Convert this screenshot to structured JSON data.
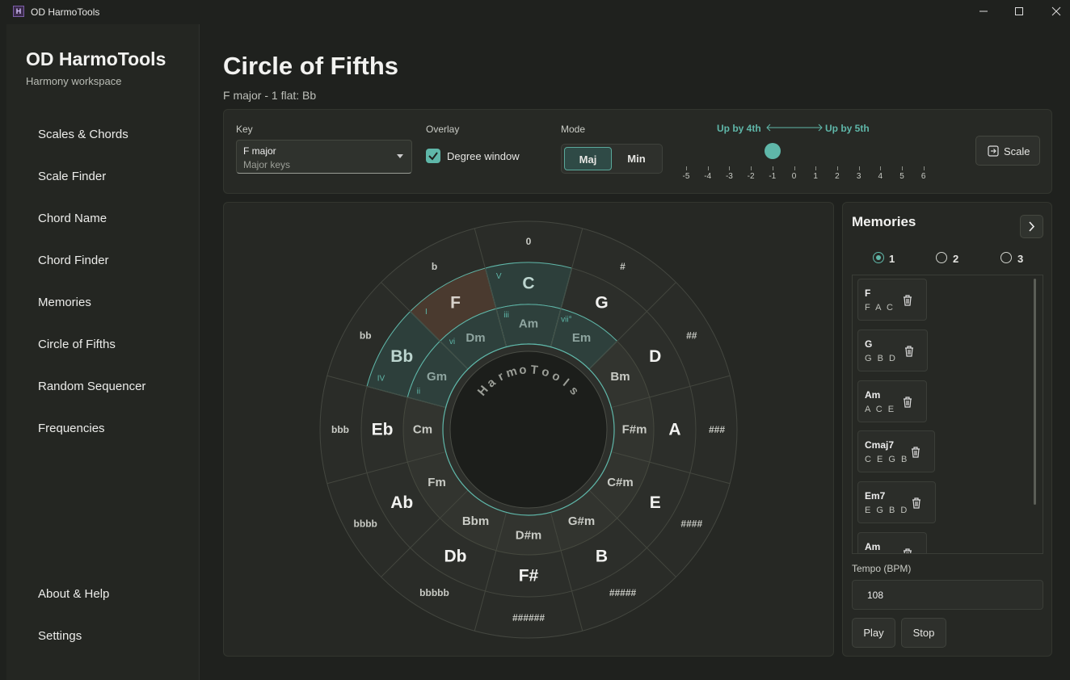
{
  "window": {
    "title": "OD HarmoTools"
  },
  "sidebar": {
    "brand": "OD HarmoTools",
    "subtitle": "Harmony workspace",
    "items": [
      {
        "label": "Scales & Chords"
      },
      {
        "label": "Scale Finder"
      },
      {
        "label": "Chord Name"
      },
      {
        "label": "Chord Finder"
      },
      {
        "label": "Memories"
      },
      {
        "label": "Circle of Fifths"
      },
      {
        "label": "Random Sequencer"
      },
      {
        "label": "Frequencies"
      }
    ],
    "footer": [
      {
        "label": "About & Help"
      },
      {
        "label": "Settings"
      }
    ]
  },
  "page": {
    "title": "Circle of Fifths",
    "subtitle": "F major - 1 flat: Bb"
  },
  "controls": {
    "key_label": "Key",
    "key_value": "F major",
    "key_sub": "Major keys",
    "overlay_label": "Overlay",
    "overlay_checkbox": "Degree window",
    "overlay_checked": true,
    "mode_label": "Mode",
    "mode_options": [
      "Maj",
      "Min"
    ],
    "mode_selected": "Maj",
    "transpose_left": "Up by 4th",
    "transpose_right": "Up by 5th",
    "transpose_ticks": [
      "-5",
      "-4",
      "-3",
      "-2",
      "-1",
      "0",
      "1",
      "2",
      "3",
      "4",
      "5",
      "6"
    ],
    "transpose_value": -1,
    "scale_button": "Scale"
  },
  "circle": {
    "center_text": "HarmoTools",
    "highlight_key": "F",
    "accent_color": "#5fb7a9",
    "highlight_color": "#4a3a2f",
    "signatures": [
      "0",
      "#",
      "##",
      "###",
      "####",
      "#####",
      "######",
      "bbbbb",
      "bbbb",
      "bbb",
      "bb",
      "b"
    ],
    "major_keys": [
      "C",
      "G",
      "D",
      "A",
      "E",
      "B",
      "F#",
      "Db",
      "Ab",
      "Eb",
      "Bb",
      "F"
    ],
    "minor_keys": [
      "Am",
      "Em",
      "Bm",
      "F#m",
      "C#m",
      "G#m",
      "D#m",
      "Bbm",
      "Fm",
      "Cm",
      "Gm",
      "Dm"
    ],
    "major_degrees": [
      {
        "key": "F",
        "degree": "I"
      },
      {
        "key": "C",
        "degree": "V"
      },
      {
        "key": "Bb",
        "degree": "IV"
      }
    ],
    "minor_degrees": [
      {
        "key": "Dm",
        "degree": "vi"
      },
      {
        "key": "Am",
        "degree": "iii"
      },
      {
        "key": "Em",
        "degree": "vii°"
      },
      {
        "key": "Gm",
        "degree": "ii"
      }
    ]
  },
  "memories": {
    "title": "Memories",
    "slots": [
      "1",
      "2",
      "3"
    ],
    "selected_slot": "1",
    "items": [
      {
        "name": "F",
        "notes": "F A C"
      },
      {
        "name": "G",
        "notes": "G B D"
      },
      {
        "name": "Am",
        "notes": "A C E"
      },
      {
        "name": "Cmaj7",
        "notes": "C E G B"
      },
      {
        "name": "Em7",
        "notes": "E G B D"
      },
      {
        "name": "Am",
        "notes": ""
      }
    ],
    "tempo_label": "Tempo (BPM)",
    "tempo_value": "108",
    "play_button": "Play",
    "stop_button": "Stop"
  }
}
